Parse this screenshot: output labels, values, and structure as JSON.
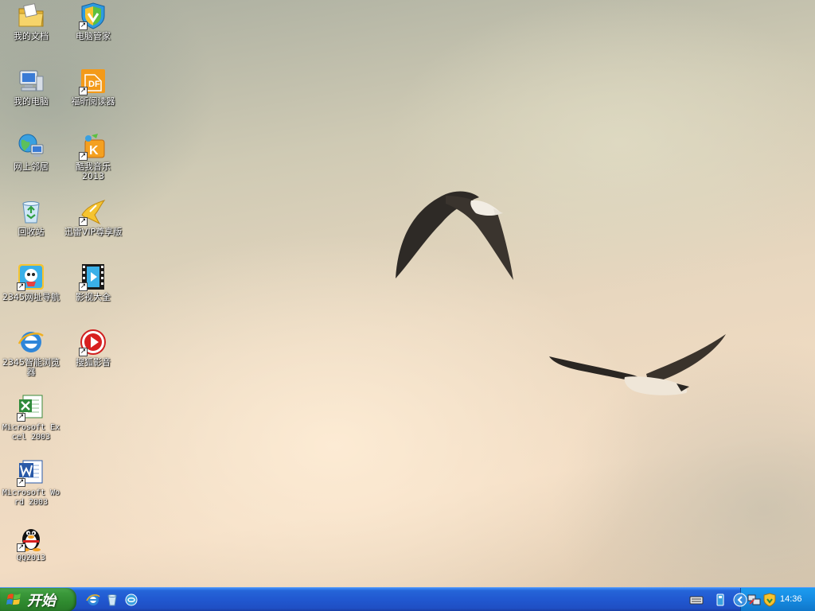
{
  "desktop": {
    "icons": [
      {
        "label": "我的文档"
      },
      {
        "label": "电脑管家"
      },
      {
        "label": "我的电脑"
      },
      {
        "label": "福昕阅读器"
      },
      {
        "label": "网上邻居"
      },
      {
        "label": "酷我音乐\n2013"
      },
      {
        "label": "回收站"
      },
      {
        "label": "迅雷VIP尊享版"
      },
      {
        "label": "2345网址导航"
      },
      {
        "label": "影视大全"
      },
      {
        "label": "2345智能浏览器"
      },
      {
        "label": "搜狐影音"
      },
      {
        "label": "Microsoft Excel 2003"
      },
      {
        "label": "Microsoft Word 2003"
      },
      {
        "label": "QQ2013"
      }
    ]
  },
  "taskbar": {
    "start_label": "开始",
    "clock": "14:36"
  },
  "colors": {
    "taskbar_blue": "#2158d0",
    "start_green": "#3c9a3c",
    "tray_blue": "#168ae0"
  }
}
